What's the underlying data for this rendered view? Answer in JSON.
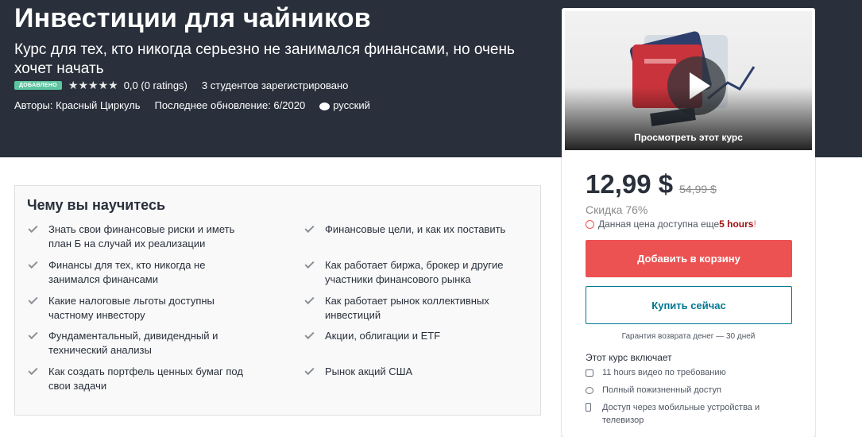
{
  "hero": {
    "title": "Инвестиции для чайников",
    "subtitle": "Курс для тех, кто никогда серьезно не занимался финансами, но очень хочет начать",
    "badge": "ДОБАВЛЕНО",
    "stars": "★★★★★",
    "rating": "0,0 (0 ratings)",
    "students": "3 студентов зарегистрировано",
    "authors": "Авторы: Красный Циркуль",
    "updated": "Последнее обновление: 6/2020",
    "language": "русский"
  },
  "sidebar": {
    "preview_label": "Просмотреть этот курс",
    "price": "12,99 $",
    "old_price": "54,99 $",
    "discount": "Скидка 76%",
    "timer_text": "Данная цена доступна еще ",
    "timer_bold": "5 hours",
    "timer_end": "!",
    "add_to_cart": "Добавить в корзину",
    "buy_now": "Купить сейчас",
    "guarantee": "Гарантия возврата денег — 30 дней",
    "includes_title": "Этот курс включает",
    "includes": [
      {
        "icon": "video-icon",
        "text": "11 hours видео по требованию"
      },
      {
        "icon": "infinity-icon",
        "text": "Полный пожизненный доступ"
      },
      {
        "icon": "phone-icon",
        "text": "Доступ через мобильные устройства и телевизор"
      }
    ],
    "accent": "#ec5252",
    "link_color": "#007791"
  },
  "learn": {
    "title": "Чему вы научитесь",
    "left": [
      "Знать свои финансовые риски и иметь план Б на случай их реализации",
      "Финансы для тех, кто никогда не занимался финансами",
      "Какие налоговые льготы доступны частному инвестору",
      "Фундаментальный, дивидендный и технический анализы",
      "Как создать портфель ценных бумаг под свои задачи"
    ],
    "right": [
      "Финансовые цели, и как их поставить",
      "Как работает биржа, брокер и другие участники финансового рынка",
      "Как работает рынок коллективных инвестиций",
      "Акции, облигации и ETF",
      "Рынок акций США"
    ]
  }
}
